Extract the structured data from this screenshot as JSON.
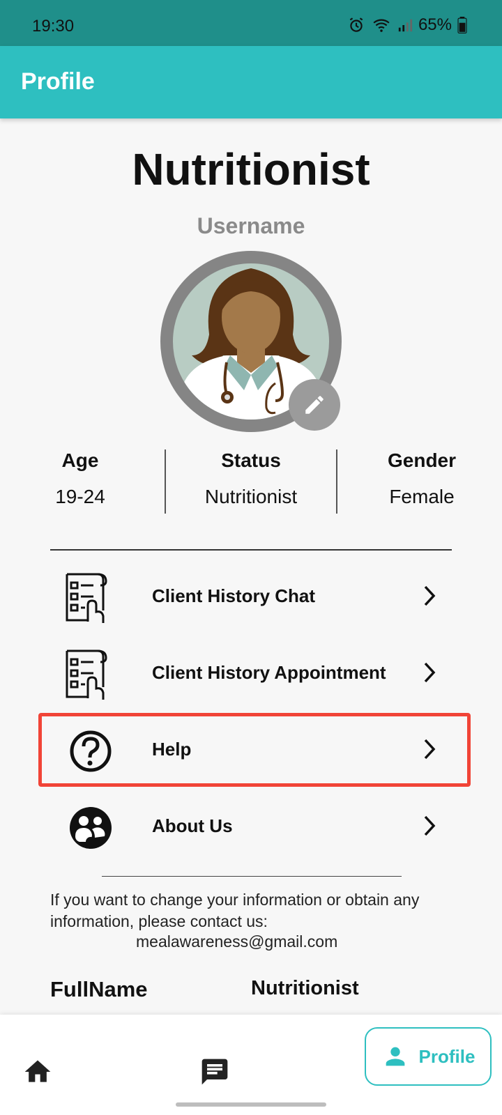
{
  "status_bar": {
    "time": "19:30",
    "battery": "65%"
  },
  "appbar": {
    "title": "Profile"
  },
  "profile": {
    "role_title": "Nutritionist",
    "username": "Username",
    "stats": [
      {
        "label": "Age",
        "value": "19-24"
      },
      {
        "label": "Status",
        "value": "Nutritionist"
      },
      {
        "label": "Gender",
        "value": "Female"
      }
    ]
  },
  "menu": {
    "items": [
      {
        "label": "Client History Chat",
        "icon": "checklist-icon"
      },
      {
        "label": "Client History Appointment",
        "icon": "checklist-icon"
      },
      {
        "label": "Help",
        "icon": "help-circle-icon"
      },
      {
        "label": "About Us",
        "icon": "group-icon"
      }
    ]
  },
  "info": {
    "message": "If you want to change your information or obtain any information, please contact us:",
    "email": "mealawareness@gmail.com"
  },
  "fields": {
    "fullname_label": "FullName",
    "fullname_value": "Nutritionist"
  },
  "bottom_nav": {
    "profile_label": "Profile"
  },
  "colors": {
    "accent": "#2ebfc0",
    "status_bar": "#1f8f8a",
    "highlight": "#f14437"
  }
}
